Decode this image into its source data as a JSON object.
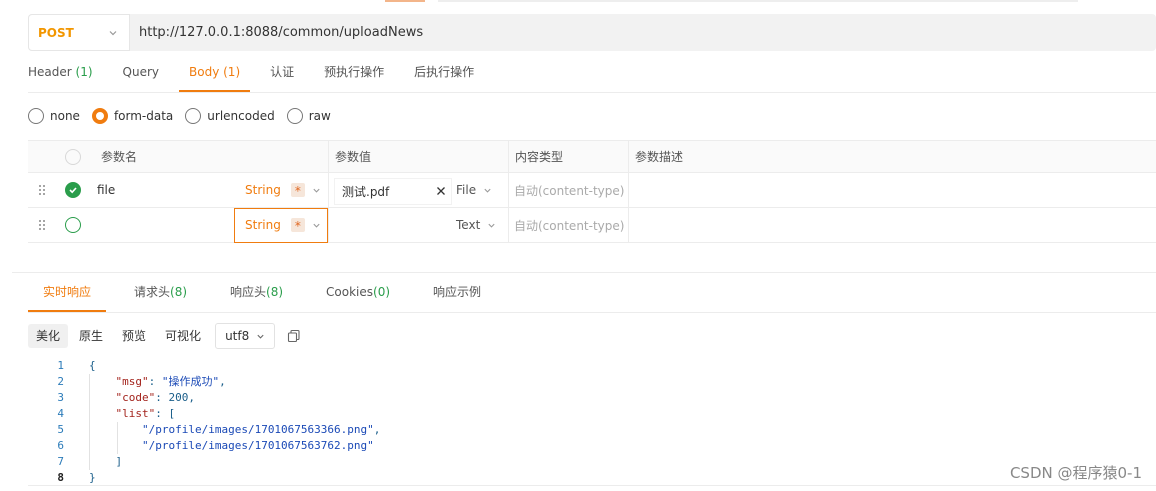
{
  "request": {
    "method": "POST",
    "url": "http://127.0.0.1:8088/common/uploadNews"
  },
  "request_tabs": [
    {
      "label": "Header",
      "count": "(1)"
    },
    {
      "label": "Query",
      "count": ""
    },
    {
      "label": "Body",
      "count": "(1)"
    },
    {
      "label": "认证",
      "count": ""
    },
    {
      "label": "预执行操作",
      "count": ""
    },
    {
      "label": "后执行操作",
      "count": ""
    }
  ],
  "body_types": [
    "none",
    "form-data",
    "urlencoded",
    "raw"
  ],
  "params_table": {
    "headers": [
      "参数名",
      "参数值",
      "内容类型",
      "参数描述"
    ],
    "rows": [
      {
        "name": "file",
        "type": "String",
        "required": "*",
        "value": "测试.pdf",
        "value_type": "File",
        "content_type": "自动(content-type)"
      },
      {
        "name": "",
        "type": "String",
        "required": "*",
        "value": "",
        "value_type": "Text",
        "content_type": "自动(content-type)"
      }
    ]
  },
  "response_tabs": [
    {
      "label": "实时响应",
      "count": ""
    },
    {
      "label": "请求头",
      "count": "(8)"
    },
    {
      "label": "响应头",
      "count": "(8)"
    },
    {
      "label": "Cookies",
      "count": "(0)"
    },
    {
      "label": "响应示例",
      "count": ""
    }
  ],
  "view_modes": [
    "美化",
    "原生",
    "预览",
    "可视化"
  ],
  "encoding": "utf8",
  "response_body": {
    "line_numbers": [
      "1",
      "2",
      "3",
      "4",
      "5",
      "6",
      "7",
      "8"
    ],
    "msg_key": "\"msg\"",
    "msg_value": "\"操作成功\"",
    "code_key": "\"code\"",
    "code_value": "200",
    "list_key": "\"list\"",
    "list_items": [
      "\"/profile/images/1701067563366.png\"",
      "\"/profile/images/1701067563762.png\""
    ]
  },
  "watermark": "CSDN @程序猿0-1",
  "colors": {
    "accent": "#f07c0f",
    "success": "#2a9d4b",
    "method": "#f29600"
  }
}
